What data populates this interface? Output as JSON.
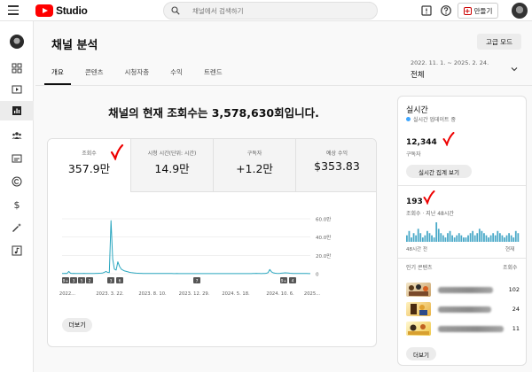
{
  "app": {
    "logo_text": "Studio",
    "brand_color": "#ff0000",
    "accent_color": "#2aa6bf"
  },
  "search": {
    "placeholder": "채널에서 검색하기"
  },
  "toolbar": {
    "create_label": "만들기"
  },
  "sidebar": {
    "items": [
      {
        "icon": "dashboard-icon"
      },
      {
        "icon": "content-icon"
      },
      {
        "icon": "analytics-icon",
        "active": true
      },
      {
        "icon": "community-icon"
      },
      {
        "icon": "subtitles-icon"
      },
      {
        "icon": "copyright-icon"
      },
      {
        "icon": "earn-icon"
      },
      {
        "icon": "customization-icon"
      },
      {
        "icon": "audio-library-icon"
      }
    ]
  },
  "page": {
    "title": "채널 분석",
    "advanced_label": "고급 모드",
    "tabs": [
      "개요",
      "콘텐츠",
      "시청자층",
      "수익",
      "트렌드"
    ],
    "date_range": "2022. 11. 1. ~ 2025. 2. 24.",
    "date_label": "전체",
    "headline": "채널의 현재 조회수는 3,578,630회입니다."
  },
  "metrics": [
    {
      "label": "조회수",
      "value": "357.9만"
    },
    {
      "label": "시청 시간(단위: 시간)",
      "value": "14.9만"
    },
    {
      "label": "구독자",
      "value": "+1.2만"
    },
    {
      "label": "예상 수익",
      "value": "$353.83"
    }
  ],
  "chart_data": {
    "type": "line",
    "y_ticks": [
      "60.0만",
      "40.0만",
      "20.0만",
      "0"
    ],
    "ylim": [
      0,
      600000
    ],
    "x_tick_labels": [
      "2022...",
      "2023. 3. 22.",
      "2023. 8. 10.",
      "2023. 12. 29.",
      "2024. 5. 18.",
      "2024. 10. 6.",
      "2025..."
    ],
    "series": [
      {
        "color": "#2aa6bf",
        "values": [
          3000,
          2000,
          4000,
          3000,
          25000,
          5000,
          3000,
          4000,
          3000,
          2000,
          3000,
          2500,
          2000,
          3500,
          2500,
          2000,
          3000,
          2500,
          2500,
          3000,
          3500,
          4000,
          5000,
          6000,
          8000,
          15000,
          25000,
          15000,
          12000,
          580000,
          160000,
          50000,
          40000,
          130000,
          80000,
          50000,
          40000,
          30000,
          25000,
          20000,
          15000,
          12000,
          10000,
          8000,
          6000,
          5000,
          4000,
          3500,
          3000,
          2500,
          2500,
          3000,
          2500,
          2000,
          2000,
          2500,
          2000,
          2000,
          1500,
          2000,
          1500,
          1500,
          2000,
          1500,
          1500,
          1500,
          1200,
          1200,
          1500,
          1200,
          1000,
          1200,
          1000,
          1000,
          1200,
          1000,
          1000,
          1000,
          800,
          1000,
          800,
          800,
          1000,
          800,
          800,
          800,
          700,
          800,
          800,
          700,
          700,
          800,
          800,
          700,
          700,
          700,
          800,
          700,
          700,
          700,
          800,
          700,
          700,
          700,
          800,
          800,
          700,
          700,
          700,
          800,
          800,
          800,
          1000,
          1500,
          2500,
          4000,
          2500,
          1500,
          1000,
          1500,
          2500,
          5000,
          12000,
          45000,
          20000,
          10000,
          6000,
          4000,
          3000,
          4000,
          6000,
          8000,
          10000,
          9000,
          7000,
          5000,
          4000,
          3000,
          3000,
          2500,
          2000,
          2000,
          2500,
          2000,
          1500,
          1500,
          1200,
          1200
        ]
      }
    ],
    "markers": [
      "9+",
      "3",
      "5",
      "2",
      "3",
      "6",
      "7",
      "9+",
      "4"
    ]
  },
  "more_label": "더보기",
  "realtime": {
    "title": "실시간",
    "status": "실시간 업데이트 중",
    "subscribers_value": "12,344",
    "subscribers_label": "구독자",
    "button_label": "실시간 집계 보기",
    "views_value": "193",
    "views_label": "조회수 · 지난 48시간",
    "bars": [
      3,
      5,
      2,
      4,
      3,
      6,
      4,
      2,
      3,
      5,
      4,
      3,
      2,
      9,
      6,
      4,
      3,
      2,
      4,
      5,
      3,
      2,
      3,
      4,
      3,
      2,
      2,
      3,
      4,
      5,
      3,
      4,
      6,
      5,
      4,
      3,
      2,
      3,
      4,
      3,
      5,
      4,
      3,
      2,
      3,
      4,
      3,
      2,
      5,
      4
    ],
    "axis_left": "48시간 전",
    "axis_right": "현재",
    "popular_title": "인기 콘텐츠",
    "popular_col": "조회수",
    "popular_counts": [
      "102",
      "24",
      "11"
    ],
    "more_label": "더보기"
  }
}
